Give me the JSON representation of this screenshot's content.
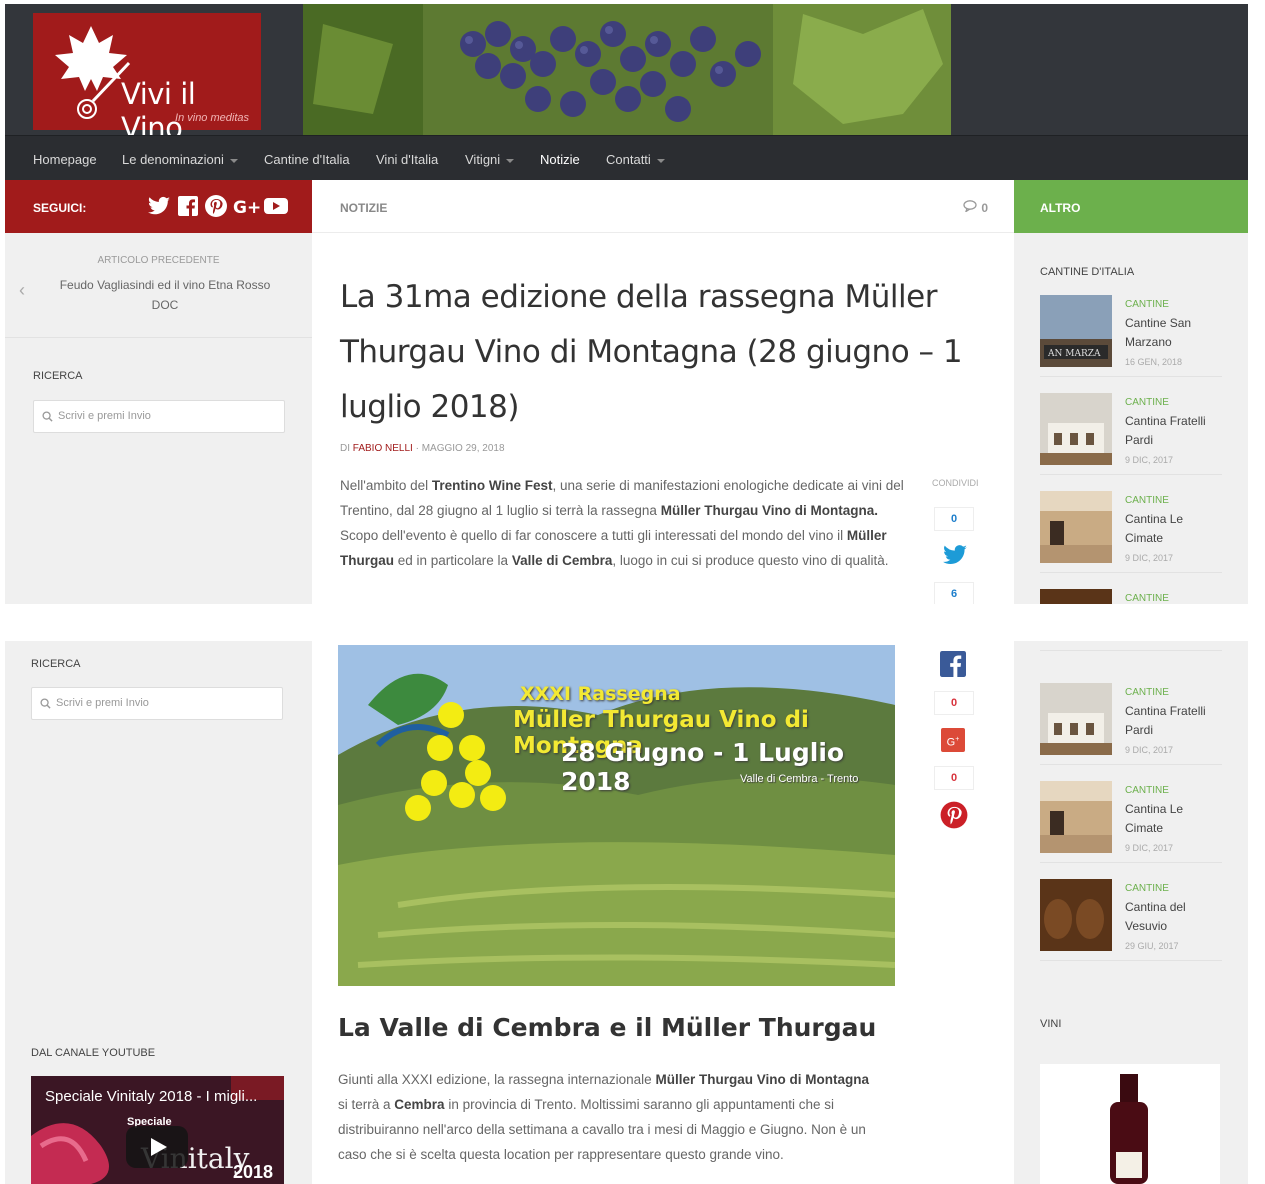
{
  "site": {
    "name": "Vivi il Vino",
    "tagline": "In vino meditas"
  },
  "nav": {
    "items": [
      {
        "label": "Homepage"
      },
      {
        "label": "Le denominazioni"
      },
      {
        "label": "Cantine d'Italia"
      },
      {
        "label": "Vini d'Italia"
      },
      {
        "label": "Vitigni"
      },
      {
        "label": "Notizie"
      },
      {
        "label": "Contatti"
      }
    ]
  },
  "follow": {
    "label": "SEGUICI:"
  },
  "breadcrumb": {
    "label": "NOTIZIE",
    "comments": "0"
  },
  "right_header": {
    "label": "ALTRO"
  },
  "prev_article": {
    "label": "ARTICOLO PRECEDENTE",
    "title": "Feudo Vagliasindi ed il vino Etna Rosso DOC"
  },
  "search": {
    "title": "RICERCA",
    "placeholder": "Scrivi e premi Invio"
  },
  "article": {
    "title": "La 31ma edizione della rassegna Müller Thurgau Vino di Montagna (28 giugno – 1 luglio 2018)",
    "meta_prefix": "DI",
    "author": "FABIO NELLI",
    "date": "· MAGGIO 29, 2018",
    "p1": [
      "Nell'ambito del ",
      "Trentino Wine Fest",
      ", una serie di manifestazioni enologiche dedicate ai vini del Trentino, dal 28 giugno al 1 luglio si terrà la rassegna ",
      "Müller Thurgau Vino di Montagna.",
      " Scopo dell'evento è quello di far conoscere a tutti gli interessati del mondo del vino il  ",
      "Müller Thurgau",
      " ed in particolare la ",
      "Valle di Cembra",
      ", luogo in cui si produce questo vino di qualità."
    ],
    "hero": {
      "line1": "XXXI Rassegna",
      "line2": "Müller Thurgau Vino di Montagna",
      "line3": "28 Giugno - 1 Luglio 2018",
      "line4": "Valle di Cembra - Trento"
    },
    "subhead_a": "La Valle di Cembra e il ",
    "subhead_b": "Müller Thurgau",
    "p2": [
      "Giunti alla XXXI edizione, la rassegna internazionale ",
      "Müller Thurgau  Vino di Montagna",
      " si terrà a ",
      "Cembra",
      " in provincia di Trento. Moltissimi saranno gli appuntamenti che si distribuiranno nell'arco della settimana a cavallo tra i mesi di Maggio e Giugno. Non è un caso che si è scelta questa location per rappresentare questo grande vino."
    ]
  },
  "share": {
    "label": "CONDIVIDI",
    "twitter": "0",
    "facebook": "6",
    "google": "0",
    "pinterest": "0"
  },
  "cantine": {
    "title": "CANTINE D'ITALIA",
    "items": [
      {
        "cat": "CANTINE",
        "name": "Cantine San Marzano",
        "date": "16 GEN, 2018"
      },
      {
        "cat": "CANTINE",
        "name": "Cantina Fratelli Pardi",
        "date": "9 DIC, 2017"
      },
      {
        "cat": "CANTINE",
        "name": "Cantina Le Cimate",
        "date": "9 DIC, 2017"
      },
      {
        "cat": "CANTINE",
        "name": "Cantina del Vesuvio",
        "date": "29 GIU, 2017"
      }
    ]
  },
  "vini": {
    "title": "VINI"
  },
  "youtube": {
    "title": "DAL CANALE YOUTUBE",
    "video_title": "Speciale Vinitaly 2018 - I migli...",
    "thumb_text_a": "Speciale",
    "thumb_text_b": "Vinitaly",
    "thumb_text_c": "2018"
  },
  "colors": {
    "brand_red": "#a11b1b",
    "accent_green": "#6cb04c",
    "nav_bg": "#2b2d31"
  }
}
